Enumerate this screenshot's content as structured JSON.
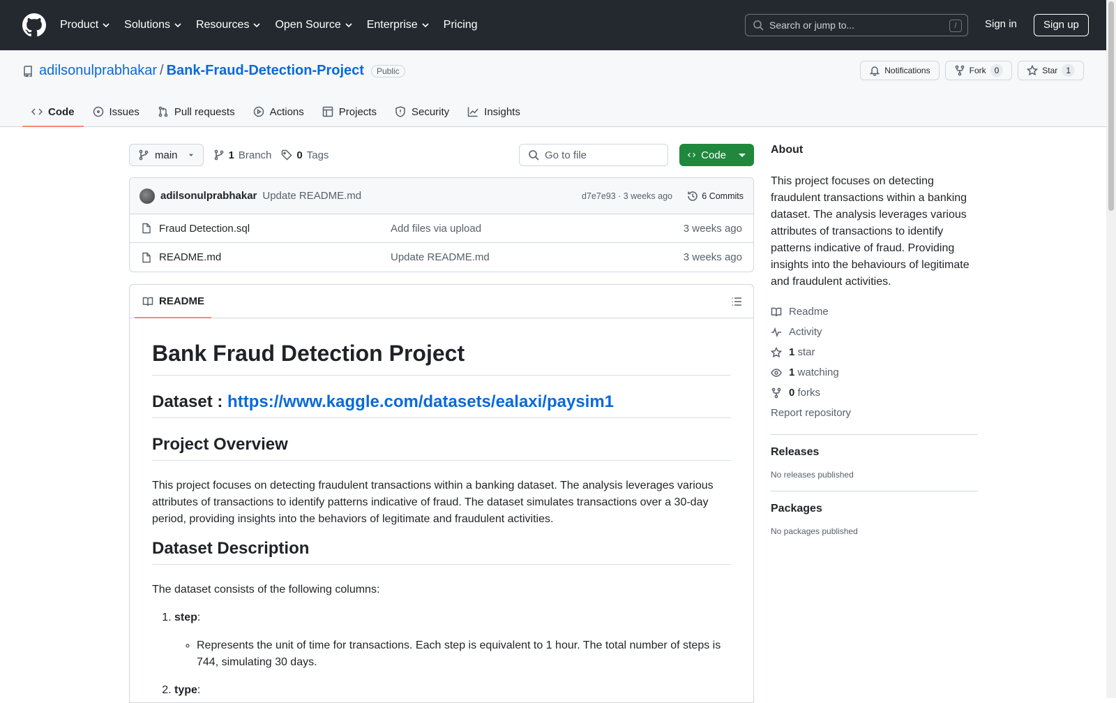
{
  "nav": {
    "items": [
      "Product",
      "Solutions",
      "Resources",
      "Open Source",
      "Enterprise",
      "Pricing"
    ],
    "search_placeholder": "Search or jump to...",
    "slash": "/",
    "signin": "Sign in",
    "signup": "Sign up"
  },
  "repo": {
    "owner": "adilsonulprabhakar",
    "sep": "/",
    "name": "Bank-Fraud-Detection-Project",
    "visibility": "Public",
    "notifications": "Notifications",
    "fork_label": "Fork",
    "fork_count": "0",
    "star_label": "Star",
    "star_count": "1",
    "tabs": [
      "Code",
      "Issues",
      "Pull requests",
      "Actions",
      "Projects",
      "Security",
      "Insights"
    ]
  },
  "main": {
    "branch": "main",
    "branch_count": "1",
    "branch_label": "Branch",
    "tag_count": "0",
    "tag_label": "Tags",
    "goto_file": "Go to file",
    "code_button": "Code",
    "commit": {
      "author": "adilsonulprabhakar",
      "message": "Update README.md",
      "hash_time": "d7e7e93 · 3 weeks ago",
      "commits": "6 Commits"
    },
    "files": [
      {
        "name": "Fraud Detection.sql",
        "message": "Add files via upload",
        "date": "3 weeks ago"
      },
      {
        "name": "README.md",
        "message": "Update README.md",
        "date": "3 weeks ago"
      }
    ],
    "readme_tab": "README"
  },
  "readme": {
    "h1": "Bank Fraud Detection Project",
    "dataset_label": "Dataset : ",
    "dataset_link": "https://www.kaggle.com/datasets/ealaxi/paysim1",
    "overview_title": "Project Overview",
    "overview_text": "This project focuses on detecting fraudulent transactions within a banking dataset. The analysis leverages various attributes of transactions to identify patterns indicative of fraud. The dataset simulates transactions over a 30-day period, providing insights into the behaviors of legitimate and fraudulent activities.",
    "desc_title": "Dataset Description",
    "desc_text": "The dataset consists of the following columns:",
    "col1_name": "step",
    "col1_desc": "Represents the unit of time for transactions. Each step is equivalent to 1 hour. The total number of steps is 744, simulating 30 days.",
    "col2_name": "type",
    "colon": ":"
  },
  "about": {
    "title": "About",
    "description": "This project focuses on detecting fraudulent transactions within a banking dataset. The analysis leverages various attributes of transactions to identify patterns indicative of fraud. Providing insights into the behaviours of legitimate and fraudulent activities.",
    "readme": "Readme",
    "activity": "Activity",
    "stars_count": "1",
    "stars_label": "star",
    "watching_count": "1",
    "watching_label": "watching",
    "forks_count": "0",
    "forks_label": "forks",
    "report": "Report repository",
    "releases_title": "Releases",
    "releases_text": "No releases published",
    "packages_title": "Packages",
    "packages_text": "No packages published"
  },
  "colors": {
    "accent": "#0969da",
    "nav_bg": "#24292f",
    "code_btn": "#1f883d",
    "tab_underline": "#fd8c73"
  }
}
